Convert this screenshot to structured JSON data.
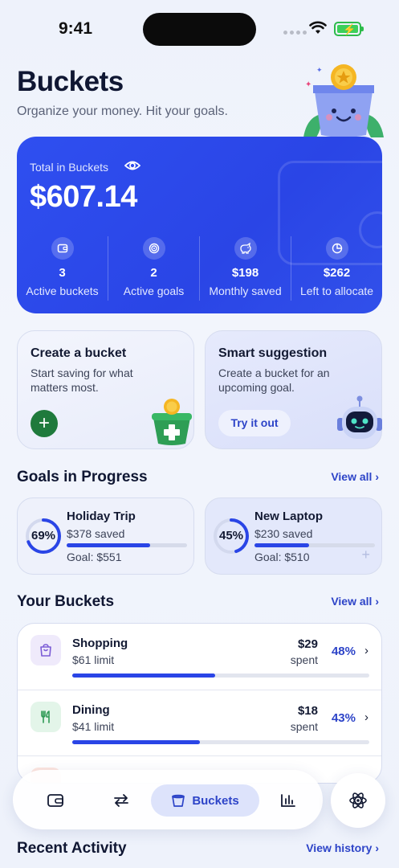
{
  "status_bar": {
    "time": "9:41"
  },
  "header": {
    "title": "Buckets",
    "subtitle": "Organize your money. Hit your goals."
  },
  "total": {
    "label": "Total in Buckets",
    "amount": "$607.14",
    "stats": [
      {
        "value": "3",
        "label": "Active buckets",
        "icon": "wallet-icon"
      },
      {
        "value": "2",
        "label": "Active goals",
        "icon": "target-icon"
      },
      {
        "value": "$198",
        "label": "Monthly saved",
        "icon": "piggy-bank-icon"
      },
      {
        "value": "$262",
        "label": "Left to allocate",
        "icon": "pie-chart-icon"
      }
    ]
  },
  "actions": {
    "create": {
      "title": "Create a bucket",
      "description": "Start saving for what matters most."
    },
    "suggestion": {
      "title": "Smart suggestion",
      "description": "Create a bucket for an upcoming goal.",
      "button": "Try it out"
    }
  },
  "goals": {
    "title": "Goals in Progress",
    "view_all": "View all",
    "items": [
      {
        "name": "Holiday Trip",
        "percent_label": "69%",
        "progress": 0.69,
        "saved": "$378 saved",
        "goal": "Goal: $551"
      },
      {
        "name": "New Laptop",
        "percent_label": "45%",
        "progress": 0.45,
        "saved": "$230 saved",
        "goal": "Goal: $510"
      }
    ]
  },
  "buckets": {
    "title": "Your Buckets",
    "view_all": "View all",
    "items": [
      {
        "name": "Shopping",
        "limit": "$61 limit",
        "spent": "$29",
        "spent_label": "spent",
        "percent": "48%",
        "progress": 0.48,
        "icon": "shopping-bag-icon",
        "color": "#7b5cd6",
        "bg": "#efeafb"
      },
      {
        "name": "Dining",
        "limit": "$41 limit",
        "spent": "$18",
        "spent_label": "spent",
        "percent": "43%",
        "progress": 0.43,
        "icon": "fork-knife-icon",
        "color": "#2e9a55",
        "bg": "#e3f5e9"
      }
    ]
  },
  "tabbar": {
    "active_label": "Buckets",
    "tabs": [
      "wallet-icon",
      "transfer-icon",
      "bucket-icon",
      "bar-chart-icon"
    ]
  },
  "recent": {
    "title": "Recent Activity",
    "view_history": "View history"
  },
  "colors": {
    "accent": "#2a45e6",
    "card": "#2f4ff0",
    "green": "#1f7a3c"
  }
}
